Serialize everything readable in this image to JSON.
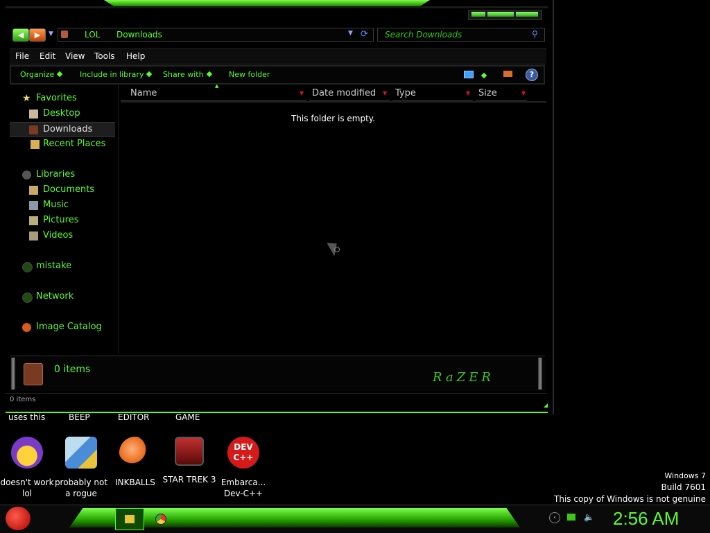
{
  "window": {
    "breadcrumb": [
      "LOL",
      "Downloads"
    ],
    "search_placeholder": "Search Downloads",
    "menu": [
      "File",
      "Edit",
      "View",
      "Tools",
      "Help"
    ],
    "commands": [
      "Organize",
      "Include in library",
      "Share with",
      "New folder"
    ],
    "help_glyph": "?",
    "nav": {
      "favorites": {
        "label": "Favorites",
        "items": [
          "Desktop",
          "Downloads",
          "Recent Places"
        ]
      },
      "libraries": {
        "label": "Libraries",
        "items": [
          "Documents",
          "Music",
          "Pictures",
          "Videos"
        ]
      },
      "homegroup": "mistake",
      "network": "Network",
      "catalog": "Image Catalog",
      "selected": "Downloads"
    },
    "columns": [
      "Name",
      "Date modified",
      "Type",
      "Size"
    ],
    "empty_message": "This folder is empty.",
    "details_count": "0 items",
    "status_text": "0 items",
    "brand": "RaZER"
  },
  "desktop": {
    "top_labels": [
      "uses this",
      "BEEP",
      "EDITOR",
      "GAME"
    ],
    "icons": [
      {
        "label": "doesn't work lol",
        "color": "#7a3cc8"
      },
      {
        "label": "probably not a rogue",
        "color": "#4a8cd8"
      },
      {
        "label": "INKBALLS",
        "color": "#e86a1a"
      },
      {
        "label": "STAR TREK 3",
        "color": "#b81818"
      },
      {
        "label": "Embarca... Dev-C++",
        "color": "#d41a1a"
      }
    ],
    "devcpp_badge": "DEV C++",
    "watermark": [
      "Windows 7",
      "Build 7601",
      "This copy of Windows is not genuine"
    ]
  },
  "taskbar": {
    "clock": "2:56 AM",
    "accent": "#5dfb2c"
  }
}
